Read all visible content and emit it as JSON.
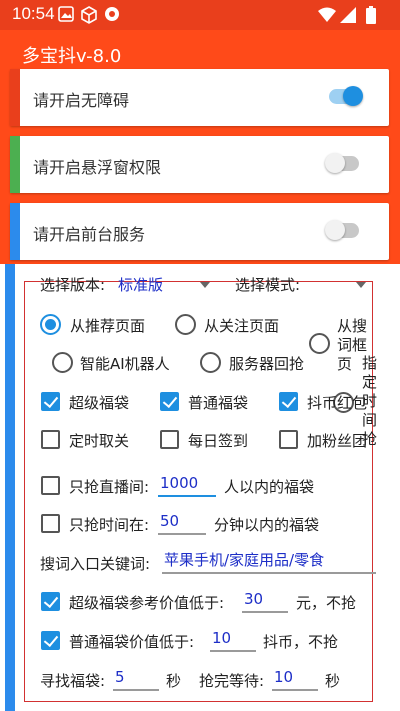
{
  "status": {
    "time": "10:54"
  },
  "app": {
    "title": "多宝抖v-8.0"
  },
  "permissions": [
    {
      "label": "请开启无障碍",
      "bar_color": "#e93f1c",
      "on": true
    },
    {
      "label": "请开启悬浮窗权限",
      "bar_color": "#4caf50",
      "on": false
    },
    {
      "label": "请开启前台服务",
      "bar_color": "#2c8bec",
      "on": false
    }
  ],
  "settings": {
    "version_label": "选择版本:",
    "version_value": "标准版",
    "mode_label": "选择模式:",
    "mode_value": "",
    "radios": {
      "recommend": "从推荐页面",
      "follow": "从关注页面",
      "search_lines": [
        "从搜",
        "词框",
        "页"
      ],
      "ai": "智能AI机器人",
      "server": "服务器回抢",
      "specified_lines": [
        "指",
        "定",
        "时",
        "间",
        "抢"
      ]
    },
    "checks": {
      "super_bag": "超级福袋",
      "normal_bag": "普通福袋",
      "coin_red": "抖币红包",
      "timed_close": "定时取关",
      "daily_sign": "每日签到",
      "add_fans": "加粉丝团"
    },
    "live_only": {
      "prefix": "只抢直播间:",
      "value": "1000",
      "suffix": "人以内的福袋"
    },
    "time_only": {
      "prefix": "只抢时间在:",
      "value": "50",
      "suffix": "分钟以内的福袋"
    },
    "keyword": {
      "label": "搜词入口关键词:",
      "value": "苹果手机/家庭用品/零食"
    },
    "super_ref": {
      "prefix": "超级福袋参考价值低于:",
      "value": "30",
      "suffix": "元，不抢"
    },
    "normal_ref": {
      "prefix": "普通福袋价值低于:",
      "value": "10",
      "suffix": "抖币，不抢"
    },
    "search_wait": {
      "label": "寻找福袋:",
      "value": "5",
      "unit": "秒"
    },
    "grab_wait": {
      "label": "抢完等待:",
      "value": "10",
      "unit": "秒"
    }
  },
  "colors": {
    "accent": "#1e8fe0",
    "header": "#ff4a19",
    "panel_border": "#d23131"
  }
}
